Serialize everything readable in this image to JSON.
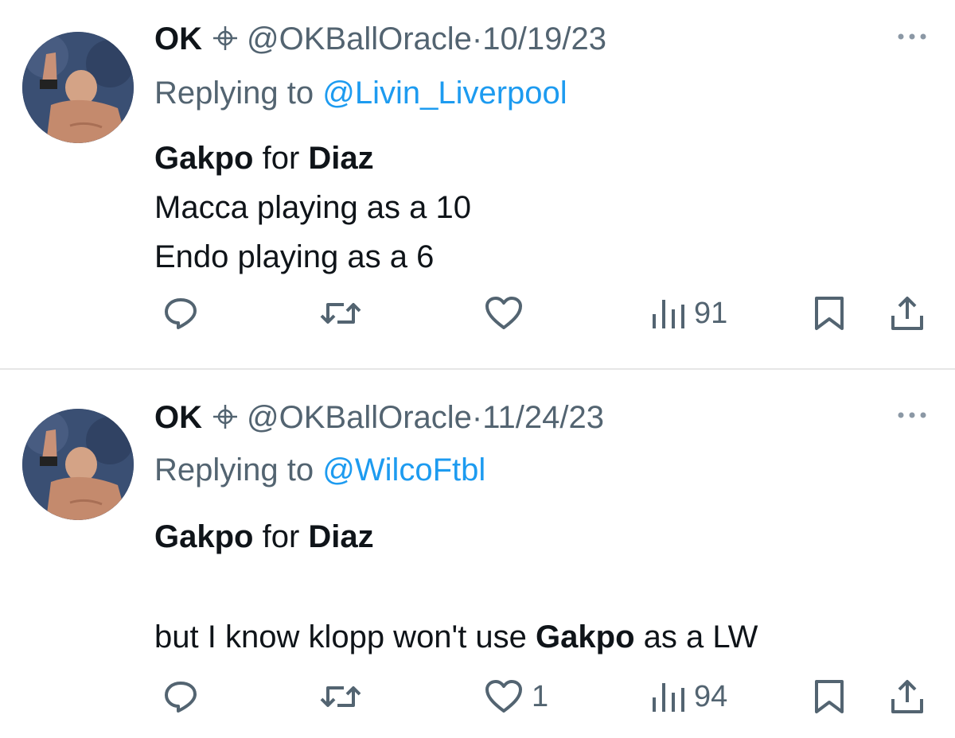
{
  "tweets": [
    {
      "author_name": "OK",
      "author_handle": "@OKBallOracle",
      "separator": "·",
      "date": "10/19/23",
      "replying_prefix": "Replying to ",
      "replying_to": "@Livin_Liverpool",
      "body": {
        "line1": {
          "player_a": "Gakpo",
          "connector": " for ",
          "player_b": "Diaz"
        },
        "line2": "Macca playing as a 10",
        "line3": "Endo playing as a 6"
      },
      "like_count": "",
      "view_count": "91"
    },
    {
      "author_name": "OK",
      "author_handle": "@OKBallOracle",
      "separator": "·",
      "date": "11/24/23",
      "replying_prefix": "Replying to ",
      "replying_to": "@WilcoFtbl",
      "body": {
        "line1": {
          "player_a": "Gakpo",
          "connector": " for ",
          "player_b": "Diaz"
        },
        "line3_pre": "but I know klopp won't use ",
        "line3_bold": "Gakpo",
        "line3_post": " as a LW"
      },
      "like_count": "1",
      "view_count": "94"
    }
  ],
  "icons": {
    "verified": "crosshair-icon",
    "more": "more-icon",
    "reply": "reply-icon",
    "retweet": "retweet-icon",
    "like": "heart-icon",
    "views": "views-icon",
    "bookmark": "bookmark-icon",
    "share": "share-icon"
  },
  "colors": {
    "text": "#0f1419",
    "secondary": "#536471",
    "link": "#1d9bf0",
    "divider": "#e6e6e6"
  }
}
